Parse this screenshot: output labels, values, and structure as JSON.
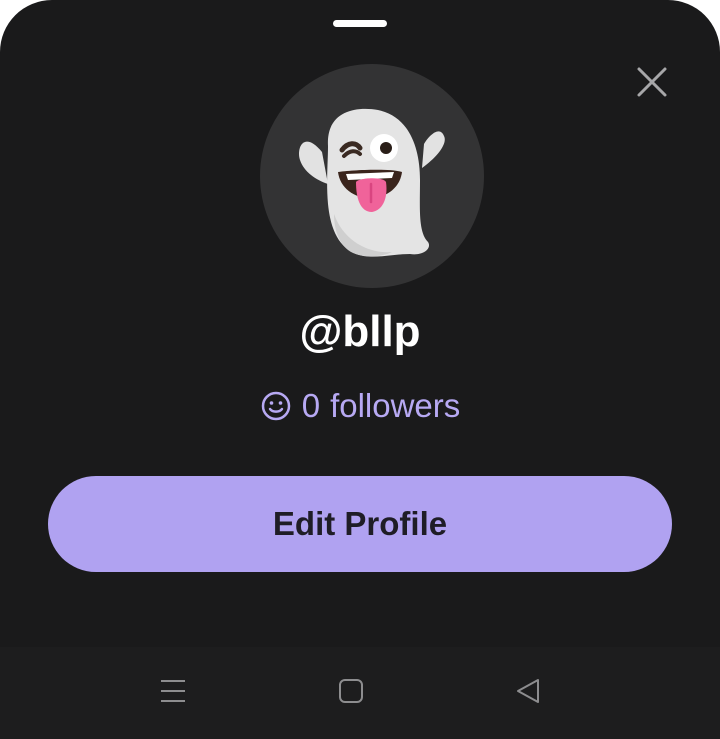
{
  "profile": {
    "username": "@bllp",
    "followers_count": "0",
    "followers_label": "followers",
    "avatar_icon": "ghost-emoji-icon"
  },
  "actions": {
    "edit_profile_label": "Edit Profile"
  },
  "icons": {
    "close": "close-icon",
    "followers": "smile-icon",
    "nav_menu": "recent-apps-icon",
    "nav_home": "home-icon",
    "nav_back": "back-icon"
  },
  "colors": {
    "background": "#1a1a1b",
    "accent": "#b0a2f1",
    "followers_text": "#b7a9f3",
    "avatar_bg": "#333334"
  }
}
